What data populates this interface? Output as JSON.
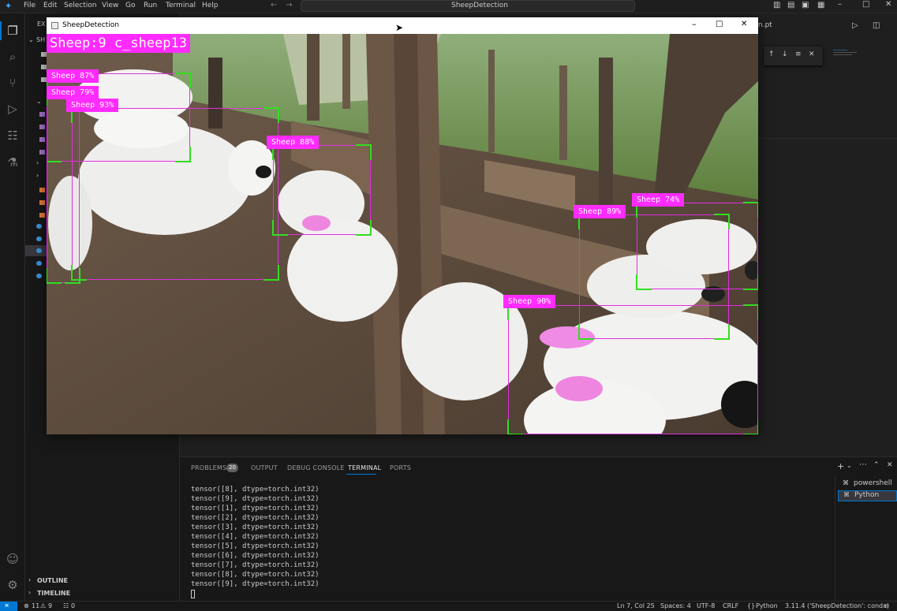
{
  "menu": [
    "File",
    "Edit",
    "Selection",
    "View",
    "Go",
    "Run",
    "Terminal",
    "Help"
  ],
  "command_center": "SheepDetection",
  "explorer_header": "EX",
  "detection_window": {
    "title": "SheepDetection",
    "count_label": "Sheep:9 c_sheep13",
    "detections": [
      {
        "label": "Sheep 87%"
      },
      {
        "label": "Sheep 79%"
      },
      {
        "label": "Sheep 93%"
      },
      {
        "label": "Sheep 88%"
      },
      {
        "label": "Sheep 89%"
      },
      {
        "label": "Sheep 74%"
      },
      {
        "label": "Sheep 90%"
      }
    ]
  },
  "editor_tab_fragment": "n.pt",
  "panel": {
    "tabs": [
      "PROBLEMS",
      "OUTPUT",
      "DEBUG CONSOLE",
      "TERMINAL",
      "PORTS"
    ],
    "problems_count": "20",
    "active_tab": "TERMINAL",
    "terminal_lines": [
      "tensor([8], dtype=torch.int32)",
      "tensor([9], dtype=torch.int32)",
      "tensor([1], dtype=torch.int32)",
      "tensor([2], dtype=torch.int32)",
      "tensor([3], dtype=torch.int32)",
      "tensor([4], dtype=torch.int32)",
      "tensor([5], dtype=torch.int32)",
      "tensor([6], dtype=torch.int32)",
      "tensor([7], dtype=torch.int32)",
      "tensor([8], dtype=torch.int32)",
      "tensor([9], dtype=torch.int32)"
    ],
    "terminals": [
      "powershell",
      "Python"
    ]
  },
  "sidebar": {
    "outline": "OUTLINE",
    "timeline": "TIMELINE"
  },
  "statusbar": {
    "errors": "11",
    "warnings": "9",
    "ports": "0",
    "position": "Ln 7, Col 25",
    "spaces": "Spaces: 4",
    "encoding": "UTF-8",
    "eol": "CRLF",
    "language": "Python",
    "interpreter": "3.11.4 ('SheepDetection': conda)"
  },
  "colors": {
    "box_border": "#e02fe0",
    "box_corner": "#33dd22",
    "label_bg": "#ff2bff",
    "editor_bg": "#1f1f1f",
    "accent": "#0078d4"
  }
}
